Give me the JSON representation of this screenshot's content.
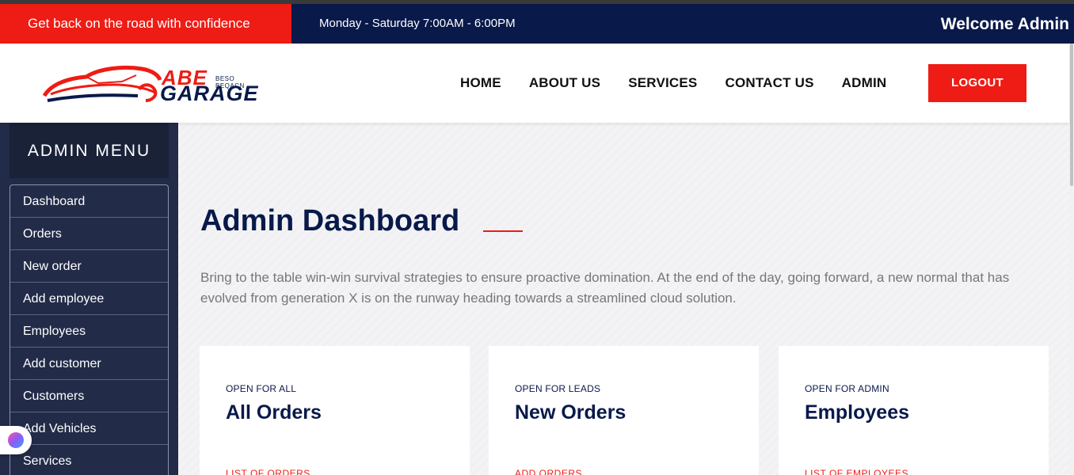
{
  "topbar": {
    "promo": "Get back on the road with confidence",
    "hours": "Monday - Saturday 7:00AM - 6:00PM",
    "welcome": "Welcome Admin"
  },
  "logo": {
    "abe": "ABE",
    "garage": "GARAGE",
    "tagline": "BESO BEQACN"
  },
  "nav": {
    "items": [
      "HOME",
      "ABOUT US",
      "SERVICES",
      "CONTACT US",
      "ADMIN"
    ],
    "logout": "LOGOUT"
  },
  "sidebar": {
    "title": "ADMIN MENU",
    "items": [
      "Dashboard",
      "Orders",
      "New order",
      "Add employee",
      "Employees",
      "Add customer",
      "Customers",
      "Add Vehicles",
      "Services"
    ]
  },
  "main": {
    "title": "Admin Dashboard",
    "intro": "Bring to the table win-win survival strategies to ensure proactive domination. At the end of the day, going forward, a new normal that has evolved from generation X is on the runway heading towards a streamlined cloud solution.",
    "cards": [
      {
        "eyebrow": "OPEN FOR ALL",
        "title": "All Orders",
        "link": "LIST OF ORDERS"
      },
      {
        "eyebrow": "OPEN FOR LEADS",
        "title": "New Orders",
        "link": "ADD ORDERS"
      },
      {
        "eyebrow": "OPEN FOR ADMIN",
        "title": "Employees",
        "link": "LIST OF EMPLOYEES"
      }
    ]
  },
  "colors": {
    "navy": "#08194a",
    "red": "#ee1c14",
    "sidebar": "#222b48"
  }
}
